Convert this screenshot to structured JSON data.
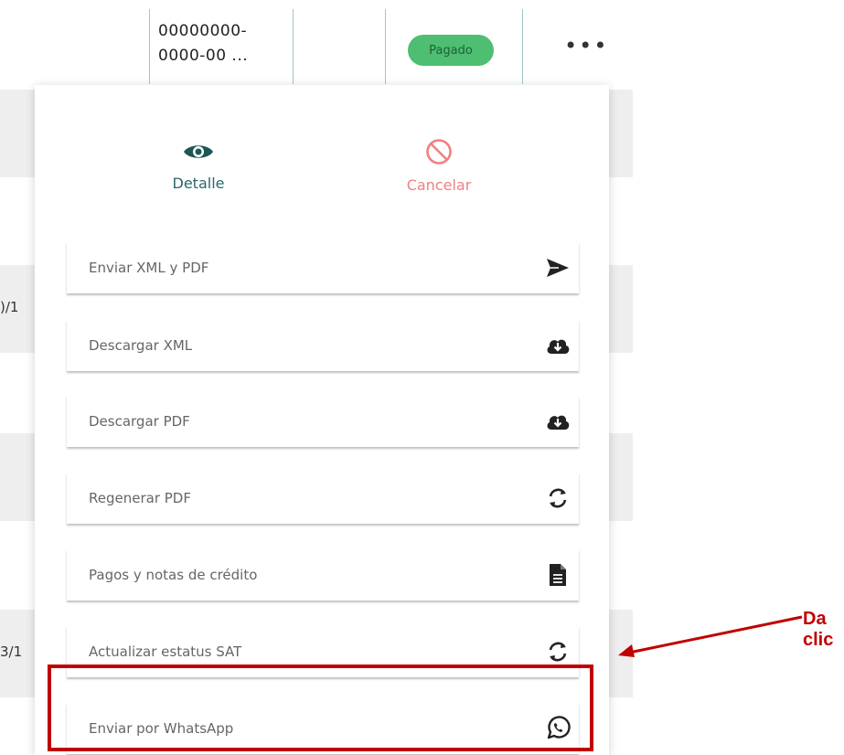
{
  "table": {
    "id_lines": [
      "00000000-",
      "0000-00 ..."
    ],
    "status_badge": "Pagado",
    "more_icon": "more-horizontal-icon",
    "fragments": [
      ")/1",
      "3/1"
    ]
  },
  "menu": {
    "top_actions": [
      {
        "label": "Detalle",
        "icon": "eye-icon",
        "color": "#2a6868"
      },
      {
        "label": "Cancelar",
        "icon": "ban-icon",
        "color": "#f08080"
      }
    ],
    "items": [
      {
        "label": "Enviar XML y PDF",
        "icon": "send-icon"
      },
      {
        "label": "Descargar XML",
        "icon": "cloud-download-icon"
      },
      {
        "label": "Descargar PDF",
        "icon": "cloud-download-icon"
      },
      {
        "label": "Regenerar PDF",
        "icon": "sync-icon"
      },
      {
        "label": "Pagos y notas de crédito",
        "icon": "file-icon"
      },
      {
        "label": "Actualizar estatus SAT",
        "icon": "sync-icon"
      },
      {
        "label": "Enviar por WhatsApp",
        "icon": "whatsapp-icon"
      }
    ]
  },
  "annotation": {
    "callout_text": "Da clic",
    "color": "#c00000"
  }
}
